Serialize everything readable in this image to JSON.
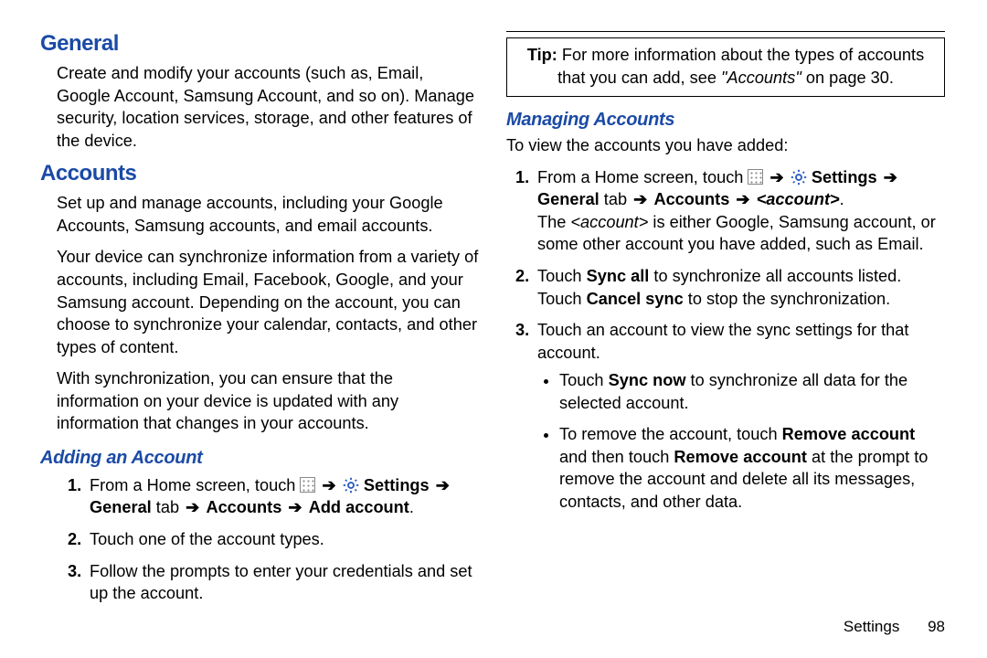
{
  "left": {
    "h_general": "General",
    "p_general": "Create and modify your accounts (such as, Email, Google Account, Samsung Account, and so on). Manage security, location services, storage, and other features of the device.",
    "h_accounts": "Accounts",
    "p_acc1": "Set up and manage accounts, including your Google Accounts, Samsung accounts, and email accounts.",
    "p_acc2": "Your device can synchronize information from a variety of accounts, including Email, Facebook, Google, and your Samsung account. Depending on the account, you can choose to synchronize your calendar, contacts, and other types of content.",
    "p_acc3": "With synchronization, you can ensure that the information on your device is updated with any information that changes in your accounts.",
    "h_adding": "Adding an Account",
    "step1_a": "From a Home screen, touch ",
    "settings_word": "Settings",
    "step1_b": "General",
    "step1_tab": " tab ",
    "step1_c": "Accounts",
    "step1_d": "Add account",
    "step2": "Touch one of the account types.",
    "step3": "Follow the prompts to enter your credentials and set up the account."
  },
  "right": {
    "tip_label": "Tip:",
    "tip_a": " For more information about the types of accounts that you can add, see ",
    "tip_ref": "\"Accounts\"",
    "tip_b": " on page 30.",
    "h_managing": "Managing Accounts",
    "intro": "To view the accounts you have added:",
    "s1_a": "From a Home screen, touch ",
    "settings_word": "Settings",
    "s1_b": "General",
    "s1_tab": " tab ",
    "s1_c": "Accounts",
    "s1_d": "<account>",
    "s1_e": "The ",
    "s1_f": "<account>",
    "s1_g": " is either Google, Samsung account, or some other account you have added, such as Email.",
    "s2_a": "Touch ",
    "s2_b": "Sync all",
    "s2_c": " to synchronize all accounts listed. Touch ",
    "s2_d": "Cancel sync",
    "s2_e": " to stop the synchronization.",
    "s3": "Touch an account to view the sync settings for that account.",
    "b1_a": "Touch ",
    "b1_b": "Sync now",
    "b1_c": " to synchronize all data for the selected account.",
    "b2_a": "To remove the account, touch ",
    "b2_b": "Remove account",
    "b2_c": " and then touch ",
    "b2_d": "Remove account",
    "b2_e": " at the prompt to remove the account and delete all its messages, contacts, and other data."
  },
  "footer": {
    "section": "Settings",
    "page": "98"
  }
}
